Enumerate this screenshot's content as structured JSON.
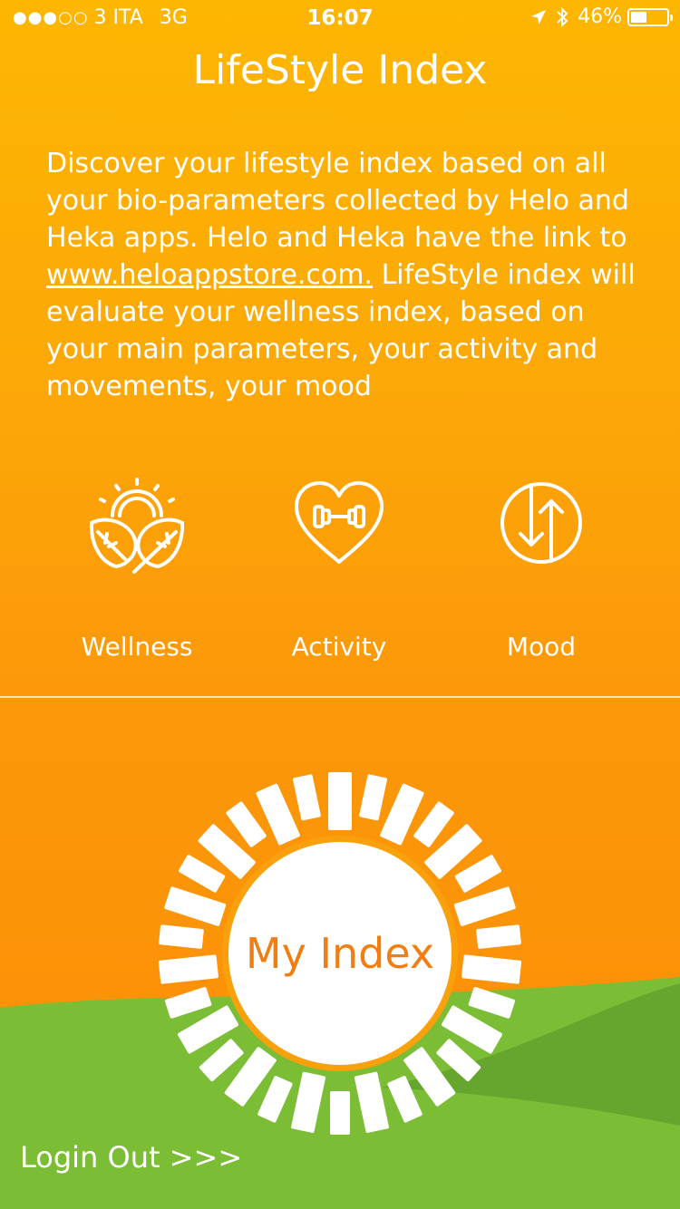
{
  "status_bar": {
    "signal": "●●●○○",
    "carrier": "3 ITA",
    "network": "3G",
    "time": "16:07",
    "location_icon": "location-arrow-icon",
    "bluetooth_icon": "bluetooth-icon",
    "battery_percent": "46%",
    "battery_level": 0.46
  },
  "header": {
    "title": "LifeStyle Index"
  },
  "description": {
    "text_before_link": "Discover your lifestyle index based on all your bio-parameters collected by Helo and Heka apps.  Helo and Heka have the link to ",
    "link_text": "www.heloappstore.com.",
    "text_after_link": " LifeStyle index will evaluate your wellness index, based on your main parameters, your activity and movements, your mood"
  },
  "features": [
    {
      "label": "Wellness",
      "icon": "wellness-sun-leaves-icon"
    },
    {
      "label": "Activity",
      "icon": "heart-dumbbell-icon"
    },
    {
      "label": "Mood",
      "icon": "up-down-arrows-icon"
    }
  ],
  "index_button": {
    "label": "My Index",
    "icon": "sun-burst-icon"
  },
  "footer": {
    "login_label": "Login Out >>>"
  },
  "colors": {
    "orange_top": "#FDB602",
    "orange_bottom": "#FC8E05",
    "green_light": "#7BBD35",
    "green_dark": "#66A52C",
    "index_text": "#F07E12"
  }
}
